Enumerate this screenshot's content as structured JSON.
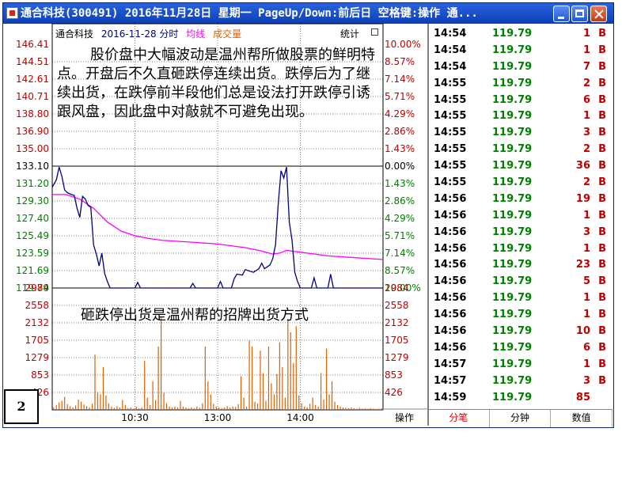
{
  "window": {
    "title": "通合科技(300491) 2016年11月28日 星期一 PageUp/Down:前后日 空格键:操作 通...",
    "minimize_icon": "minimize-icon",
    "maximize_icon": "maximize-icon",
    "close_icon": "close-icon"
  },
  "chart_header": {
    "stock_name": "通合科技",
    "date_label": "2016-11-28 分时",
    "avg_label": "均线",
    "volume_label": "成交量",
    "stats_label": "统计"
  },
  "colors": {
    "price_line": "#000080",
    "avg_line": "#ff00ff",
    "volume_bar": "#e06000",
    "up_label": "#c00000",
    "down_label": "#008000"
  },
  "annotations": {
    "main": "股价盘中大幅波动是温州帮所做股票的鲜明特点。开盘后不久直砸跌停连续出货。跌停后为了继续出货，在跌停前半段他们总是设法打开跌停引诱跟风盘，因此盘中对敲就不可避免出现。",
    "volume": "砸跌停出货是温州帮的招牌出货方式"
  },
  "page_badge": "2",
  "operate_button": "操作",
  "chart_data": {
    "type": "line",
    "price_ticks": [
      "146.41",
      "144.51",
      "142.61",
      "140.71",
      "138.80",
      "136.90",
      "135.00",
      "133.10",
      "131.20",
      "129.30",
      "127.40",
      "125.49",
      "123.59",
      "121.69",
      "119.79"
    ],
    "pct_ticks": [
      "10.00%",
      "8.57%",
      "7.14%",
      "5.71%",
      "4.29%",
      "2.86%",
      "1.43%",
      "0.00%",
      "1.43%",
      "2.86%",
      "4.29%",
      "5.71%",
      "7.14%",
      "8.57%",
      "10.00%"
    ],
    "volume_ticks": [
      "2984",
      "2558",
      "2132",
      "1705",
      "1279",
      "853",
      "426"
    ],
    "x_ticks": [
      "10:30",
      "13:00",
      "14:00"
    ],
    "ylim": [
      119.79,
      146.41
    ],
    "volume_ylim": [
      0,
      2984
    ],
    "sessions": 240,
    "price_series": [
      [
        0,
        130.8
      ],
      [
        3,
        131.6
      ],
      [
        5,
        133.0
      ],
      [
        7,
        132.0
      ],
      [
        9,
        130.5
      ],
      [
        11,
        130.2
      ],
      [
        14,
        130.0
      ],
      [
        16,
        129.9
      ],
      [
        18,
        128.5
      ],
      [
        20,
        127.5
      ],
      [
        22,
        129.8
      ],
      [
        24,
        129.5
      ],
      [
        26,
        128.8
      ],
      [
        28,
        128.6
      ],
      [
        30,
        124.5
      ],
      [
        32,
        123.5
      ],
      [
        34,
        122.2
      ],
      [
        36,
        123.6
      ],
      [
        38,
        121.4
      ],
      [
        40,
        120.5
      ],
      [
        42,
        119.79
      ],
      [
        60,
        119.79
      ],
      [
        62,
        120.4
      ],
      [
        64,
        119.79
      ],
      [
        100,
        119.79
      ],
      [
        102,
        120.3
      ],
      [
        104,
        119.79
      ],
      [
        120,
        119.79
      ],
      [
        122,
        120.5
      ],
      [
        124,
        119.79
      ],
      [
        130,
        119.79
      ],
      [
        132,
        120.8
      ],
      [
        134,
        121.3
      ],
      [
        138,
        121.2
      ],
      [
        140,
        121.8
      ],
      [
        146,
        121.5
      ],
      [
        150,
        121.9
      ],
      [
        152,
        122.5
      ],
      [
        154,
        121.9
      ],
      [
        158,
        122.3
      ],
      [
        160,
        123.0
      ],
      [
        162,
        124.5
      ],
      [
        164,
        129.0
      ],
      [
        166,
        132.6
      ],
      [
        168,
        131.8
      ],
      [
        170,
        133.0
      ],
      [
        172,
        127.0
      ],
      [
        174,
        125.0
      ],
      [
        176,
        121.5
      ],
      [
        178,
        120.5
      ],
      [
        180,
        119.79
      ],
      [
        188,
        119.79
      ],
      [
        190,
        120.9
      ],
      [
        192,
        119.79
      ],
      [
        200,
        119.79
      ],
      [
        202,
        121.3
      ],
      [
        204,
        119.79
      ],
      [
        240,
        119.79
      ]
    ],
    "avg_series": [
      [
        0,
        130.0
      ],
      [
        10,
        130.0
      ],
      [
        20,
        129.5
      ],
      [
        30,
        128.5
      ],
      [
        40,
        127.0
      ],
      [
        50,
        126.0
      ],
      [
        60,
        125.5
      ],
      [
        70,
        125.2
      ],
      [
        80,
        125.0
      ],
      [
        100,
        124.8
      ],
      [
        120,
        124.6
      ],
      [
        140,
        124.2
      ],
      [
        150,
        123.9
      ],
      [
        160,
        123.5
      ],
      [
        165,
        123.6
      ],
      [
        170,
        123.9
      ],
      [
        180,
        123.7
      ],
      [
        200,
        123.3
      ],
      [
        220,
        123.1
      ],
      [
        240,
        122.9
      ]
    ],
    "volume_series": [
      [
        1,
        60
      ],
      [
        3,
        120
      ],
      [
        5,
        180
      ],
      [
        7,
        220
      ],
      [
        9,
        320
      ],
      [
        11,
        140
      ],
      [
        13,
        90
      ],
      [
        15,
        60
      ],
      [
        17,
        110
      ],
      [
        19,
        250
      ],
      [
        21,
        200
      ],
      [
        23,
        130
      ],
      [
        25,
        90
      ],
      [
        27,
        60
      ],
      [
        29,
        150
      ],
      [
        31,
        1350
      ],
      [
        33,
        420
      ],
      [
        35,
        380
      ],
      [
        37,
        1050
      ],
      [
        39,
        350
      ],
      [
        41,
        160
      ],
      [
        43,
        80
      ],
      [
        45,
        50
      ],
      [
        47,
        90
      ],
      [
        49,
        60
      ],
      [
        51,
        240
      ],
      [
        53,
        120
      ],
      [
        55,
        40
      ],
      [
        57,
        60
      ],
      [
        59,
        30
      ],
      [
        61,
        80
      ],
      [
        63,
        40
      ],
      [
        65,
        60
      ],
      [
        67,
        1200
      ],
      [
        69,
        300
      ],
      [
        71,
        120
      ],
      [
        73,
        700
      ],
      [
        75,
        240
      ],
      [
        77,
        1550
      ],
      [
        79,
        2250
      ],
      [
        81,
        420
      ],
      [
        83,
        160
      ],
      [
        85,
        80
      ],
      [
        87,
        60
      ],
      [
        89,
        80
      ],
      [
        91,
        60
      ],
      [
        93,
        220
      ],
      [
        95,
        80
      ],
      [
        97,
        60
      ],
      [
        99,
        40
      ],
      [
        101,
        60
      ],
      [
        103,
        40
      ],
      [
        105,
        80
      ],
      [
        107,
        50
      ],
      [
        109,
        160
      ],
      [
        111,
        1550
      ],
      [
        113,
        700
      ],
      [
        115,
        380
      ],
      [
        117,
        150
      ],
      [
        119,
        80
      ],
      [
        121,
        60
      ],
      [
        123,
        40
      ],
      [
        125,
        60
      ],
      [
        127,
        90
      ],
      [
        129,
        60
      ],
      [
        131,
        80
      ],
      [
        133,
        70
      ],
      [
        135,
        140
      ],
      [
        137,
        820
      ],
      [
        139,
        300
      ],
      [
        141,
        80
      ],
      [
        143,
        1700
      ],
      [
        145,
        1550
      ],
      [
        147,
        200
      ],
      [
        149,
        160
      ],
      [
        151,
        1450
      ],
      [
        153,
        900
      ],
      [
        155,
        220
      ],
      [
        157,
        1550
      ],
      [
        159,
        650
      ],
      [
        161,
        380
      ],
      [
        163,
        880
      ],
      [
        165,
        1650
      ],
      [
        167,
        1050
      ],
      [
        169,
        300
      ],
      [
        171,
        2230
      ],
      [
        173,
        1900
      ],
      [
        175,
        1150
      ],
      [
        177,
        2050
      ],
      [
        179,
        350
      ],
      [
        181,
        160
      ],
      [
        183,
        80
      ],
      [
        185,
        60
      ],
      [
        187,
        150
      ],
      [
        189,
        300
      ],
      [
        191,
        120
      ],
      [
        193,
        80
      ],
      [
        195,
        900
      ],
      [
        197,
        250
      ],
      [
        199,
        1500
      ],
      [
        201,
        380
      ],
      [
        203,
        700
      ],
      [
        205,
        200
      ],
      [
        207,
        120
      ],
      [
        209,
        80
      ],
      [
        211,
        60
      ],
      [
        213,
        50
      ],
      [
        215,
        40
      ],
      [
        217,
        60
      ],
      [
        219,
        40
      ],
      [
        221,
        30
      ],
      [
        223,
        50
      ],
      [
        225,
        30
      ],
      [
        227,
        40
      ],
      [
        229,
        30
      ],
      [
        231,
        40
      ],
      [
        233,
        30
      ],
      [
        235,
        20
      ],
      [
        237,
        30
      ],
      [
        239,
        40
      ]
    ]
  },
  "trades": [
    {
      "time": "14:54",
      "price": "119.79",
      "vol": "1",
      "side": "B"
    },
    {
      "time": "14:54",
      "price": "119.79",
      "vol": "1",
      "side": "B"
    },
    {
      "time": "14:54",
      "price": "119.79",
      "vol": "7",
      "side": "B"
    },
    {
      "time": "14:55",
      "price": "119.79",
      "vol": "2",
      "side": "B"
    },
    {
      "time": "14:55",
      "price": "119.79",
      "vol": "6",
      "side": "B"
    },
    {
      "time": "14:55",
      "price": "119.79",
      "vol": "1",
      "side": "B"
    },
    {
      "time": "14:55",
      "price": "119.79",
      "vol": "3",
      "side": "B"
    },
    {
      "time": "14:55",
      "price": "119.79",
      "vol": "2",
      "side": "B"
    },
    {
      "time": "14:55",
      "price": "119.79",
      "vol": "36",
      "side": "B"
    },
    {
      "time": "14:55",
      "price": "119.79",
      "vol": "2",
      "side": "B"
    },
    {
      "time": "14:56",
      "price": "119.79",
      "vol": "19",
      "side": "B"
    },
    {
      "time": "14:56",
      "price": "119.79",
      "vol": "1",
      "side": "B"
    },
    {
      "time": "14:56",
      "price": "119.79",
      "vol": "3",
      "side": "B"
    },
    {
      "time": "14:56",
      "price": "119.79",
      "vol": "1",
      "side": "B"
    },
    {
      "time": "14:56",
      "price": "119.79",
      "vol": "23",
      "side": "B"
    },
    {
      "time": "14:56",
      "price": "119.79",
      "vol": "5",
      "side": "B"
    },
    {
      "time": "14:56",
      "price": "119.79",
      "vol": "1",
      "side": "B"
    },
    {
      "time": "14:56",
      "price": "119.79",
      "vol": "1",
      "side": "B"
    },
    {
      "time": "14:56",
      "price": "119.79",
      "vol": "10",
      "side": "B"
    },
    {
      "time": "14:56",
      "price": "119.79",
      "vol": "6",
      "side": "B"
    },
    {
      "time": "14:57",
      "price": "119.79",
      "vol": "1",
      "side": "B"
    },
    {
      "time": "14:57",
      "price": "119.79",
      "vol": "3",
      "side": "B"
    },
    {
      "time": "14:59",
      "price": "119.79",
      "vol": "85",
      "side": ""
    }
  ],
  "tabs": [
    {
      "label": "分笔",
      "active": true
    },
    {
      "label": "分钟",
      "active": false
    },
    {
      "label": "数值",
      "active": false
    }
  ]
}
